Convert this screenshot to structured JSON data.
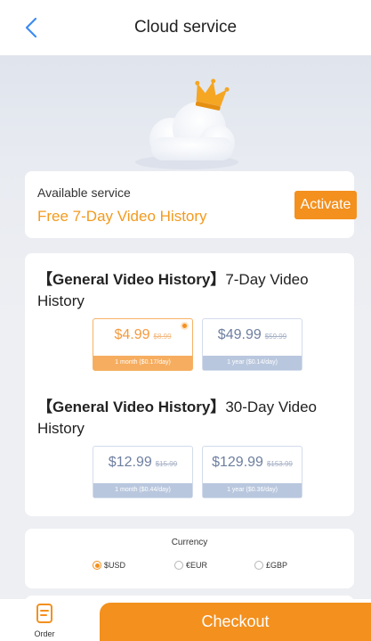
{
  "header": {
    "title": "Cloud service"
  },
  "service": {
    "label": "Available service",
    "name": "Free 7-Day Video History",
    "activate_label": "Activate"
  },
  "plans": [
    {
      "title_bold": "【General Video History】",
      "title_rest": "7-Day Video History",
      "options": [
        {
          "price": "$4.99",
          "original": "$8.99",
          "footnote": "1 month ($0.17/day)",
          "selected": true
        },
        {
          "price": "$49.99",
          "original": "$59.99",
          "footnote": "1 year ($0.14/day)",
          "selected": false
        }
      ]
    },
    {
      "title_bold": "【General Video History】",
      "title_rest": "30-Day Video History",
      "options": [
        {
          "price": "$12.99",
          "original": "$15.99",
          "footnote": "1 month ($0.44/day)",
          "selected": false
        },
        {
          "price": "$129.99",
          "original": "$153.99",
          "footnote": "1 year ($0.36/day)",
          "selected": false
        }
      ]
    }
  ],
  "currency": {
    "title": "Currency",
    "options": [
      {
        "label": "$USD",
        "selected": true
      },
      {
        "label": "€EUR",
        "selected": false
      },
      {
        "label": "£GBP",
        "selected": false
      }
    ]
  },
  "bottom": {
    "order_label": "Order",
    "checkout_label": "Checkout"
  },
  "colors": {
    "accent": "#f3901e",
    "accent_text": "#f39a1e",
    "unselected_footer": "#b9c7de"
  },
  "icons": {
    "back": "chevron-left-icon",
    "crown": "crown-icon",
    "order": "order-document-icon"
  }
}
